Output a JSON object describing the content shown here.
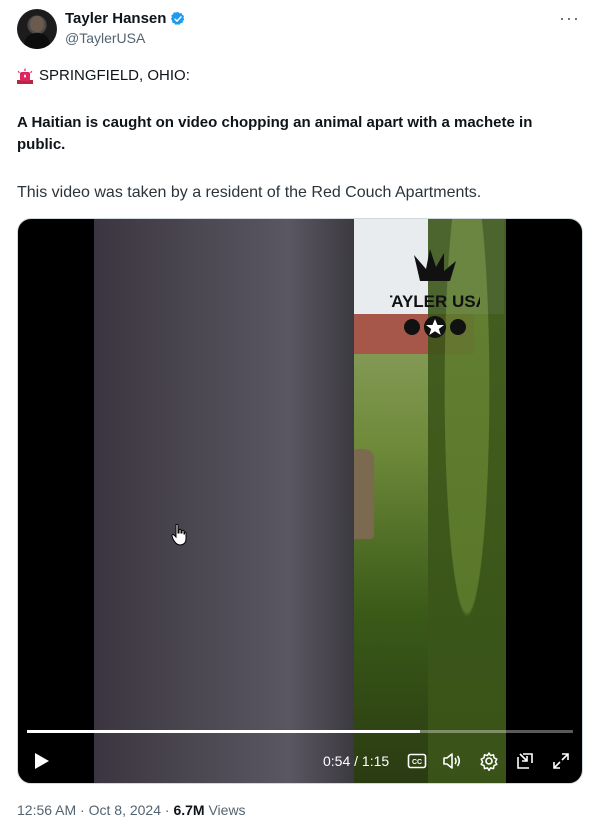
{
  "author": {
    "name": "Tayler Hansen",
    "handle": "@TaylerUSA"
  },
  "tweet": {
    "line1": "SPRINGFIELD, OHIO:",
    "line2": "A Haitian is caught on video chopping an animal apart with a machete in public.",
    "line3": "This video was taken by a resident of the Red Couch Apartments."
  },
  "video": {
    "watermark": "TAYLER USA",
    "current_time": "0:54",
    "duration": "1:15",
    "time_display": "0:54 / 1:15",
    "progress": 0.72,
    "cc_label": "CC"
  },
  "meta": {
    "time": "12:56 AM",
    "date": "Oct 8, 2024",
    "views_count": "6.7M",
    "views_label": "Views"
  },
  "icons": [
    "verified-badge-icon",
    "more-icon",
    "siren-icon",
    "play-icon",
    "captions-icon",
    "volume-icon",
    "settings-icon",
    "pip-icon",
    "fullscreen-icon",
    "cursor-icon"
  ],
  "colors": {
    "verified": "#1d9bf0",
    "siren": "#e0245e",
    "text": "#0f1419",
    "muted": "#536471"
  }
}
